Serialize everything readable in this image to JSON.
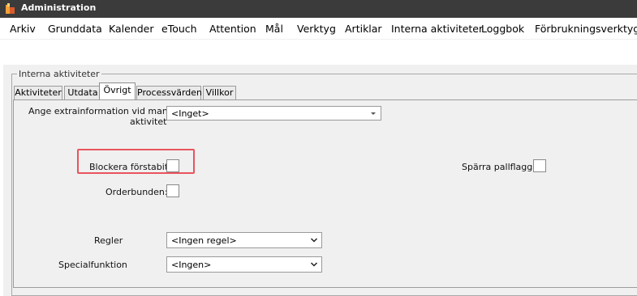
{
  "window": {
    "title": "Administration",
    "icon": "app-logo-icon"
  },
  "menu": {
    "items": [
      "Arkiv",
      "Grunddata",
      "Kalender",
      "eTouch",
      "Attention",
      "Mål",
      "Verktyg",
      "Artiklar",
      "Interna aktiviteter",
      "Loggbok",
      "Förbrukningsverktyg"
    ]
  },
  "group": {
    "title": "Interna aktiviteter"
  },
  "tabs": {
    "items": [
      "Aktiviteter",
      "Utdata",
      "Övrigt",
      "Processvärden",
      "Villkor"
    ],
    "active": "Övrigt"
  },
  "form": {
    "extrainfo": {
      "label_line1": "Ange extrainformation vid manuell",
      "label_line2": "aktivitet",
      "value": "<Inget>"
    },
    "blockera": {
      "label": "Blockera förstabit:",
      "checked": false
    },
    "orderbunden": {
      "label": "Orderbunden:",
      "checked": false
    },
    "sparra": {
      "label": "Spärra pallflagga:",
      "checked": false
    },
    "regler": {
      "label": "Regler",
      "value": "<Ingen regel>"
    },
    "special": {
      "label": "Specialfunktion",
      "value": "<Ingen>"
    }
  },
  "colors": {
    "titlebar": "#3b3b3b",
    "highlight": "#e8545d",
    "panel": "#f0f0f0"
  }
}
